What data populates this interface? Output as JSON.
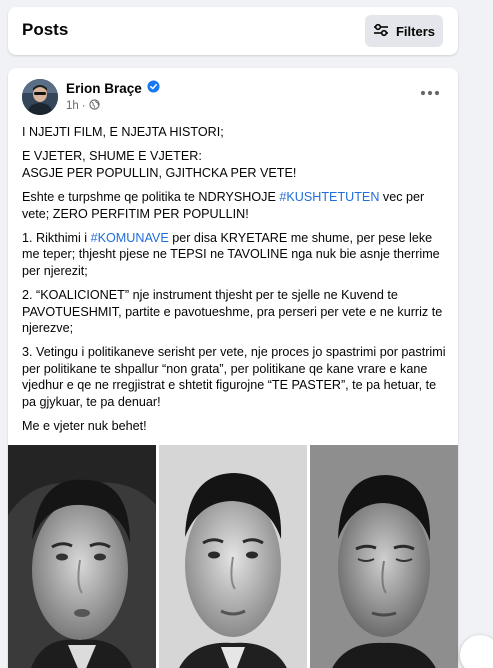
{
  "header": {
    "title": "Posts",
    "filters_label": "Filters"
  },
  "post": {
    "author": "Erion Braçe",
    "time": "1h",
    "paragraphs": [
      [
        {
          "t": "I NJEJTI FILM, E NJEJTA HISTORI;"
        }
      ],
      [
        {
          "t": "E VJETER, SHUME E VJETER:"
        },
        {
          "br": true
        },
        {
          "t": "ASGJE PER POPULLIN, GJITHCKA PER VETE!"
        }
      ],
      [
        {
          "t": "Eshte e turpshme qe politika te NDRYSHOJE "
        },
        {
          "tag": "#KUSHTETUTEN"
        },
        {
          "t": " vec per vete; ZERO PERFITIM PER POPULLIN!"
        }
      ],
      [
        {
          "t": "1. Rikthimi i "
        },
        {
          "tag": "#KOMUNAVE"
        },
        {
          "t": " per disa KRYETARE me shume, per pese leke me teper; thjesht pjese ne TEPSI ne TAVOLINE nga nuk bie asnje therrime per njerezit;"
        }
      ],
      [
        {
          "t": "2. “KOALICIONET” nje instrument thjesht per te sjelle ne Kuvend te PAVOTUESHMIT, partite e pavotueshme, pra perseri per vete e ne kurriz te njerezve;"
        }
      ],
      [
        {
          "t": "3. Vetingu i politikaneve serisht per vete, nje proces jo spastrimi por pastrimi per politikane te shpallur “non grata”, per politikane qe kane vrare e kane vjedhur e qe ne rregjistrat e shtetit figurojne “TE PASTER”, te pa hetuar, te pa gjykuar, te pa denuar!"
        }
      ],
      [
        {
          "t": "Me e vjeter nuk behet!"
        }
      ]
    ]
  },
  "colors": {
    "accent": "#216fdb",
    "verified": "#1877f2",
    "background": "#f0f2f5"
  },
  "icons": {
    "filters": "sliders-icon",
    "verified": "verified-badge-icon",
    "audience": "globe-icon",
    "more": "more-dots-icon"
  }
}
